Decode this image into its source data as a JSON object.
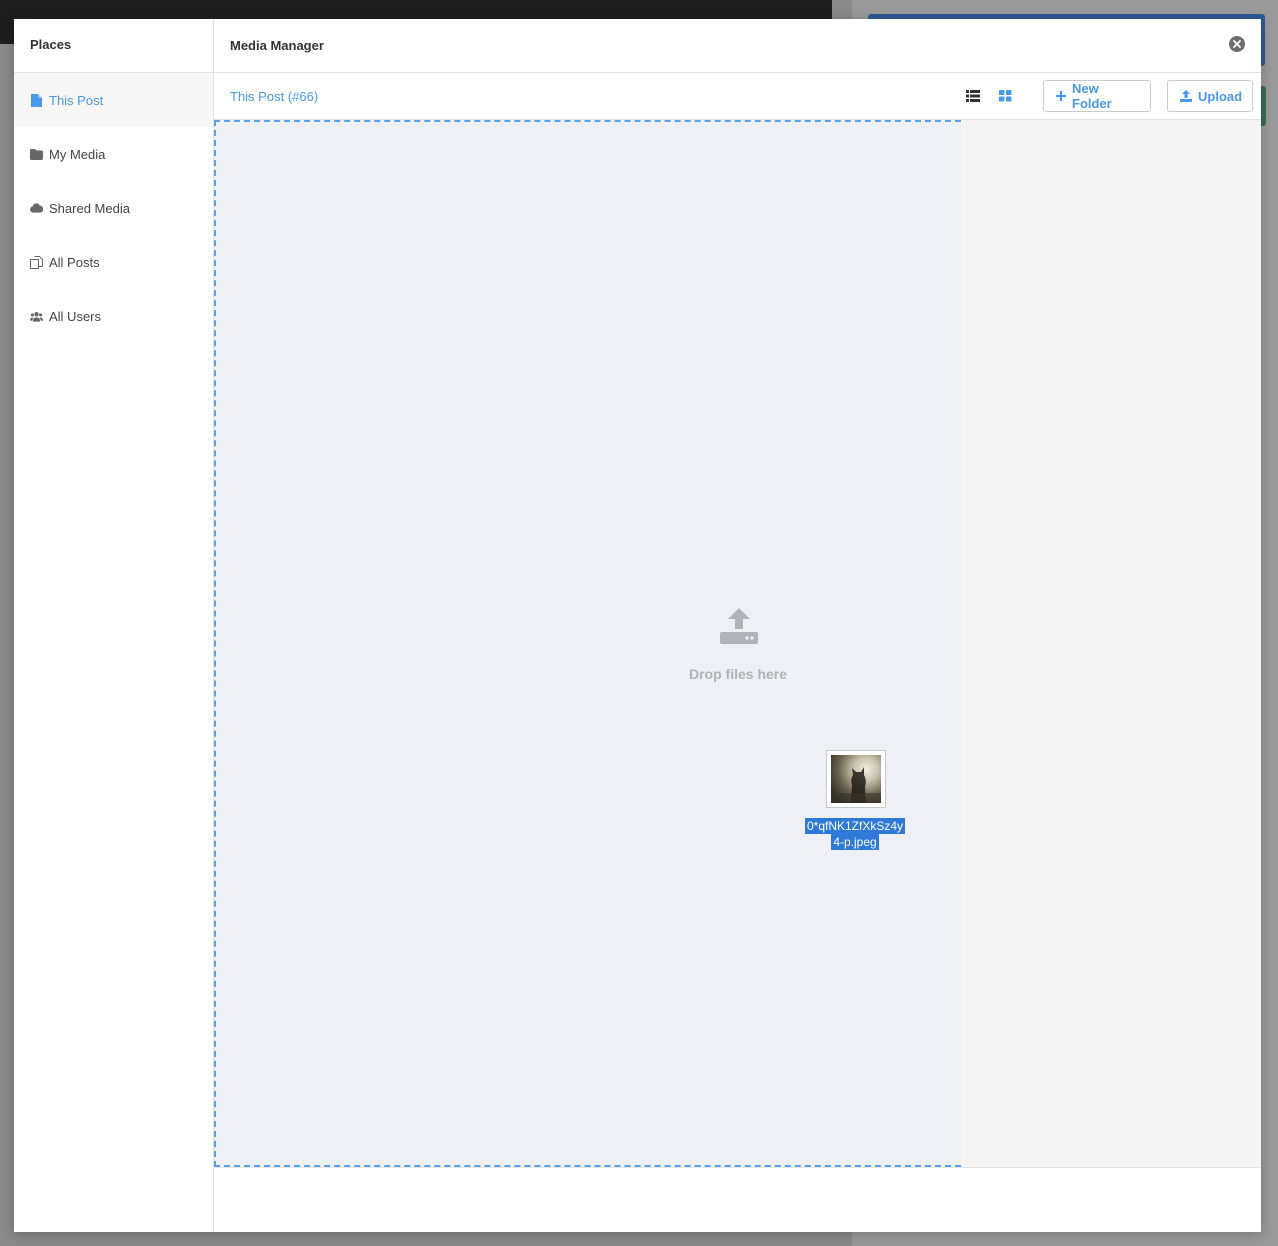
{
  "sidebar": {
    "title": "Places",
    "items": [
      {
        "label": "This Post",
        "icon": "file-icon",
        "active": true
      },
      {
        "label": "My Media",
        "icon": "folder-icon",
        "active": false
      },
      {
        "label": "Shared Media",
        "icon": "cloud-icon",
        "active": false
      },
      {
        "label": "All Posts",
        "icon": "posts-icon",
        "active": false
      },
      {
        "label": "All Users",
        "icon": "users-icon",
        "active": false
      }
    ]
  },
  "header": {
    "title": "Media Manager",
    "close_icon": "close-circle-icon"
  },
  "toolbar": {
    "breadcrumb": "This Post (#66)",
    "view_list_icon": "list-view-icon",
    "view_grid_icon": "grid-view-icon",
    "new_folder_label": "New Folder",
    "upload_label": "Upload"
  },
  "dropzone": {
    "text": "Drop files here",
    "icon": "upload-icon"
  },
  "dragged_file": {
    "name": "0*qfNK1ZfXkSz4y4-p.jpeg",
    "name_line1": "0*qfNK1ZfXkSz4y",
    "name_line2": "4-p.jpeg"
  },
  "colors": {
    "accent": "#4b98e6",
    "dropzone_bg": "#eff0f5",
    "drag_label_bg": "#2f79d8"
  }
}
